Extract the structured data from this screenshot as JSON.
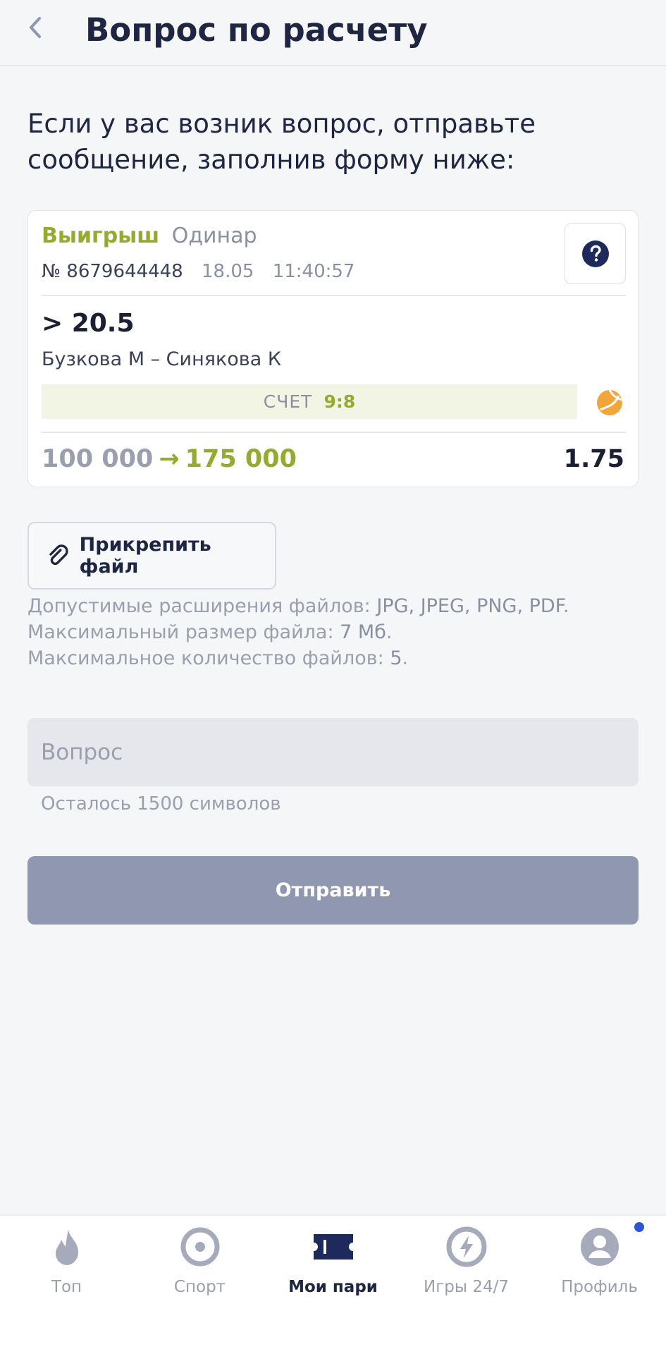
{
  "header": {
    "back_icon": "chevron-left-icon",
    "title": "Вопрос по расчету"
  },
  "intro": {
    "line1": "Если у вас возник вопрос, отправьте",
    "line2": "сообщение, заполнив форму ниже:"
  },
  "bet": {
    "status": "Выигрыш",
    "type": "Одинар",
    "number": "№ 8679644448",
    "date": "18.05",
    "time": "11:40:57",
    "help_icon": "question-circle-icon",
    "outcome": "> 20.5",
    "event": "Бузкова М – Синякова К",
    "score_label": "СЧЕТ",
    "score_value": "9:8",
    "sport_icon": "tennis-ball-icon",
    "stake": "100 000",
    "arrow": "→",
    "payout": "175 000",
    "odds": "1.75"
  },
  "attach": {
    "icon": "paperclip-icon",
    "label": "Прикрепить файл"
  },
  "file_rules": {
    "ext_prefix": "Допустимые расширения файлов: ",
    "ext_value": "JPG, JPEG, PNG, PDF",
    "size_prefix": "Максимальный размер файла: ",
    "size_value": "7 Мб",
    "count_prefix": "Максимальное количество файлов: ",
    "count_value": "5"
  },
  "question": {
    "placeholder": "Вопрос",
    "value": "",
    "counter": "Осталось 1500 символов"
  },
  "submit": {
    "label": "Отправить"
  },
  "tabbar": {
    "items": [
      {
        "label": "Топ",
        "icon": "flame-icon",
        "active": false
      },
      {
        "label": "Спорт",
        "icon": "target-icon",
        "active": false
      },
      {
        "label": "Мои пари",
        "icon": "ticket-icon",
        "active": true
      },
      {
        "label": "Игры 24/7",
        "icon": "lightning-icon",
        "active": false
      },
      {
        "label": "Профиль",
        "icon": "user-icon",
        "active": false,
        "notification": true
      }
    ]
  },
  "colors": {
    "accent_green": "#96aa31",
    "primary_dark": "#1f2641",
    "button_disabled": "#9097b0",
    "notification": "#2b55d6"
  }
}
